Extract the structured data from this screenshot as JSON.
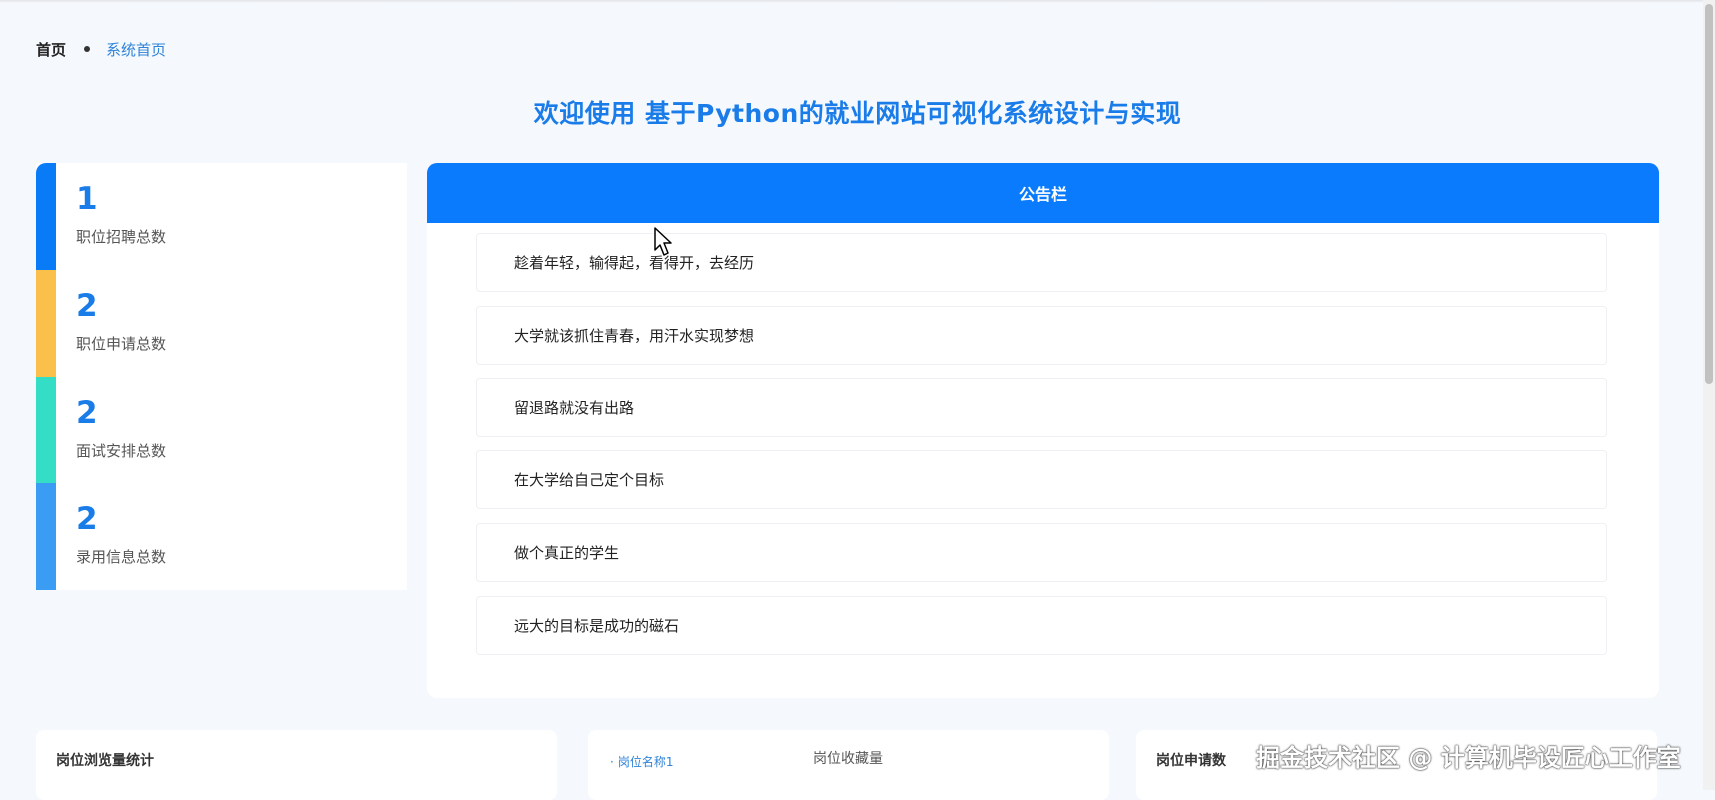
{
  "breadcrumb": {
    "home": "首页",
    "current": "系统首页"
  },
  "welcome": "欢迎使用 基于Python的就业网站可视化系统设计与实现",
  "stats": [
    {
      "value": "1",
      "label": "职位招聘总数",
      "color": "#0a7bf7"
    },
    {
      "value": "2",
      "label": "职位申请总数",
      "color": "#fbc04c"
    },
    {
      "value": "2",
      "label": "面试安排总数",
      "color": "#33ddc6"
    },
    {
      "value": "2",
      "label": "录用信息总数",
      "color": "#3a9cf2"
    }
  ],
  "notice": {
    "title": "公告栏",
    "items": [
      "趁着年轻，输得起，看得开，去经历",
      "大学就该抓住青春，用汗水实现梦想",
      "留退路就没有出路",
      "在大学给自己定个目标",
      "做个真正的学生",
      "远大的目标是成功的磁石"
    ]
  },
  "panels": {
    "views": {
      "title": "岗位浏览量统计"
    },
    "favorites": {
      "legend_item": "岗位名称1",
      "chart_title": "岗位收藏量"
    },
    "applications": {
      "title": "岗位申请数"
    }
  },
  "watermark": "掘金技术社区 @ 计算机毕设匠心工作室",
  "colors": {
    "accent": "#1a7ce8",
    "notice_header": "#0a7bfc"
  }
}
